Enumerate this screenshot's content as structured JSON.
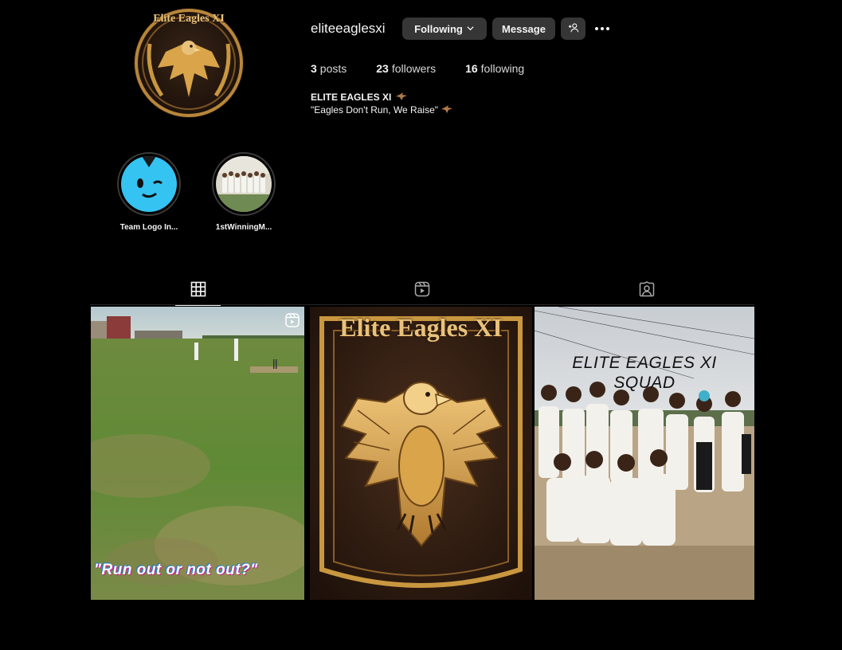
{
  "profile": {
    "username": "eliteeaglesxi",
    "following_label": "Following",
    "message_label": "Message",
    "avatar_text": "Elite Eagles XI"
  },
  "stats": {
    "posts_count": "3",
    "posts_label": "posts",
    "followers_count": "23",
    "followers_label": "followers",
    "following_count": "16",
    "following_label": "following"
  },
  "bio": {
    "name": "ELITE EAGLES XI",
    "text": "\"Eagles Don't Run, We Raise\""
  },
  "highlights": [
    {
      "label": "Team Logo In..."
    },
    {
      "label": "1stWinningM..."
    }
  ],
  "tabs": [
    {
      "name": "posts",
      "icon": "grid-icon"
    },
    {
      "name": "reels",
      "icon": "reels-icon"
    },
    {
      "name": "tagged",
      "icon": "tagged-icon"
    }
  ],
  "posts": [
    {
      "type": "reel",
      "caption": "\"Run out or not out?\""
    },
    {
      "type": "image",
      "caption": "Elite Eagles XI"
    },
    {
      "type": "image",
      "caption_line1": "ELITE EAGLES XI",
      "caption_line2": "SQUAD"
    }
  ],
  "colors": {
    "background": "#000000",
    "button": "#363636",
    "gold": "#d9a44a"
  }
}
